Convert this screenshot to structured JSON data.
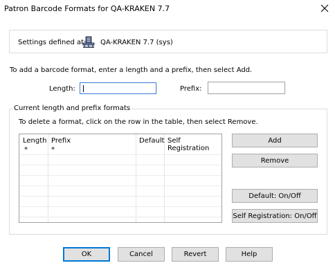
{
  "window": {
    "title": "Patron Barcode Formats for QA-KRAKEN 7.7"
  },
  "settings": {
    "label": "Settings defined at:",
    "value": "QA-KRAKEN 7.7 (sys)",
    "icon": "server-icon"
  },
  "add_instruction": "To add a barcode format, enter a length and a prefix, then select Add.",
  "length": {
    "label": "Length:",
    "value": ""
  },
  "prefix": {
    "label": "Prefix:",
    "value": ""
  },
  "group": {
    "title": "Current length and prefix formats",
    "instruction": "To delete a format, click on the row in the table, then select Remove."
  },
  "table": {
    "columns": [
      "Length",
      "Prefix",
      "Default",
      "Self Registration"
    ],
    "rows": [
      [
        "*",
        "*",
        "",
        ""
      ]
    ]
  },
  "side_buttons": {
    "add": "Add",
    "remove": "Remove",
    "default": "Default: On/Off",
    "self_registration": "Self Registration: On/Off"
  },
  "footer_buttons": {
    "ok": "OK",
    "cancel": "Cancel",
    "revert": "Revert",
    "help": "Help"
  }
}
